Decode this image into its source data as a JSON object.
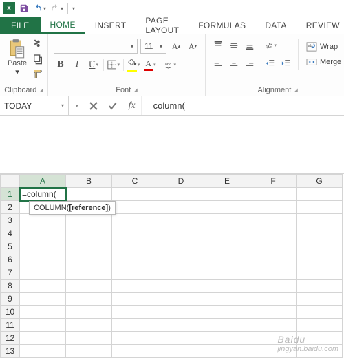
{
  "qat": {
    "app_letter": "X"
  },
  "tabs": {
    "file": "FILE",
    "home": "HOME",
    "insert": "INSERT",
    "page_layout": "PAGE LAYOUT",
    "formulas": "FORMULAS",
    "data": "DATA",
    "review": "REVIEW"
  },
  "clipboard": {
    "paste": "Paste",
    "label": "Clipboard"
  },
  "font": {
    "name": "",
    "size": "11",
    "grow": "A",
    "shrink": "A",
    "bold": "B",
    "italic": "I",
    "underline": "U",
    "color_letter": "A",
    "label": "Font"
  },
  "alignment": {
    "wrap": "Wrap",
    "merge": "Merge",
    "label": "Alignment"
  },
  "namebox": "TODAY",
  "fx_label": "fx",
  "formula": "=column(",
  "cell_value": "=column(",
  "tooltip": {
    "fn": "COLUMN(",
    "arg": "[reference]",
    "close": ")"
  },
  "columns": [
    "A",
    "B",
    "C",
    "D",
    "E",
    "F",
    "G"
  ],
  "rows": [
    "1",
    "2",
    "3",
    "4",
    "5",
    "6",
    "7",
    "8",
    "9",
    "10",
    "11",
    "12",
    "13"
  ],
  "watermark": {
    "line1": "Baidu",
    "line2": "jingyan.baidu.com"
  }
}
